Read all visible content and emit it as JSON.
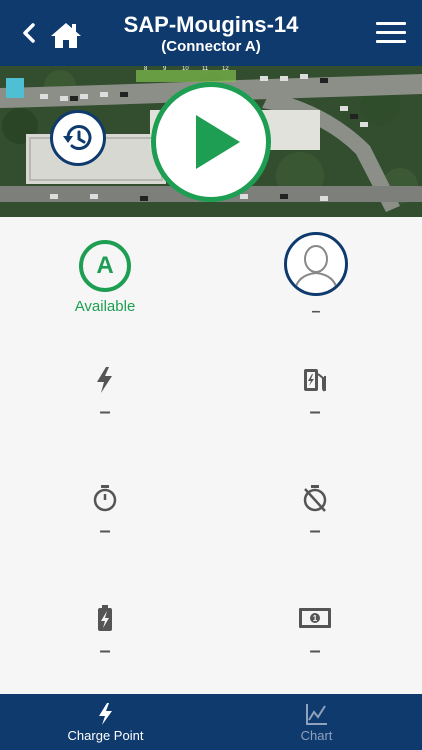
{
  "header": {
    "title": "SAP-Mougins-14",
    "subtitle": "(Connector A)"
  },
  "icons": {
    "back": "chevron-left-icon",
    "home": "home-icon",
    "menu": "hamburger-menu-icon",
    "history": "history-icon",
    "play": "play-icon",
    "power": "lightning-bolt-icon",
    "energy": "fuel-pump-icon",
    "duration": "stopwatch-icon",
    "idle_duration": "stopwatch-off-icon",
    "battery": "battery-charging-icon",
    "cost": "banknote-icon",
    "chart": "line-chart-icon"
  },
  "map": {
    "parking_labels": [
      "8",
      "9",
      "10",
      "11",
      "12"
    ]
  },
  "status": {
    "connector_letter": "A",
    "text": "Available"
  },
  "user": {
    "value": "–"
  },
  "metrics": {
    "power": "–",
    "energy": "–",
    "duration": "–",
    "idle_duration": "–",
    "battery": "–",
    "cost": "–"
  },
  "tabs": [
    {
      "label": "Charge Point",
      "active": true
    },
    {
      "label": "Chart",
      "active": false
    }
  ],
  "colors": {
    "primary": "#0e3a6e",
    "available_green": "#1e9e52",
    "icon_gray": "#555555",
    "inactive_tab": "#8fa2bc"
  }
}
